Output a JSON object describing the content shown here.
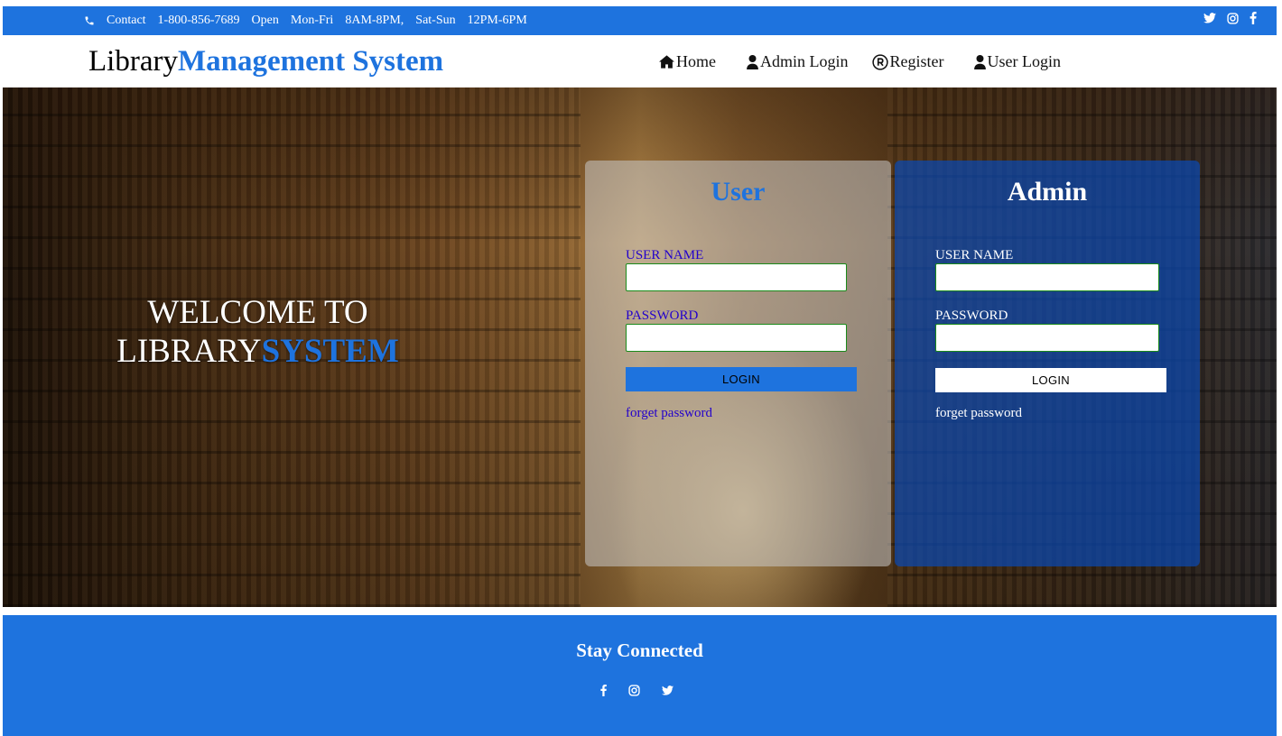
{
  "topbar": {
    "contact_label": "Contact",
    "phone": "1-800-856-7689",
    "open_label": "Open",
    "weekday_days": "Mon-Fri",
    "weekday_hours": "8AM-8PM,",
    "weekend_days": "Sat-Sun",
    "weekend_hours": "12PM-6PM",
    "social_icons": [
      "twitter-icon",
      "instagram-icon",
      "facebook-icon"
    ]
  },
  "header": {
    "brand_part1": "Library",
    "brand_part2": "Management System",
    "nav": {
      "home": "Home",
      "admin_login": "Admin Login",
      "register": "Register",
      "user_login": "User Login"
    },
    "nav_icons": [
      "home-icon",
      "user-icon",
      "registered-icon",
      "user-icon"
    ]
  },
  "hero": {
    "welcome_line1": "WELCOME TO",
    "welcome_line2_a": "LIBRARY",
    "welcome_line2_b": "SYSTEM",
    "user_panel": {
      "title": "User",
      "username_label": "USER NAME",
      "username_value": "",
      "password_label": "PASSWORD",
      "password_value": "",
      "login_button": "LOGIN",
      "forgot_link": "forget password"
    },
    "admin_panel": {
      "title": "Admin",
      "username_label": "USER NAME",
      "username_value": "",
      "password_label": "PASSWORD",
      "password_value": "",
      "login_button": "LOGIN",
      "forgot_link": "forget password"
    }
  },
  "footer": {
    "title": "Stay Connected",
    "social_icons": [
      "facebook-icon",
      "instagram-icon",
      "twitter-icon"
    ]
  },
  "colors": {
    "brand_blue": "#1e73de",
    "admin_panel": "#0a48b2",
    "link_purple": "#2200cc",
    "input_border": "#1a8a1a"
  }
}
